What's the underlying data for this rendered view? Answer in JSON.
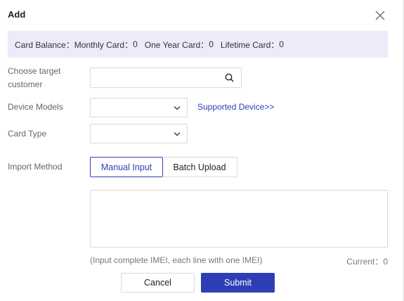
{
  "dialog": {
    "title": "Add"
  },
  "balance": {
    "card_balance_label": "Card Balance：",
    "monthly_label": "Monthly Card：",
    "monthly_value": "0",
    "one_year_label": "One Year Card：",
    "one_year_value": "0",
    "lifetime_label": "Lifetime Card：",
    "lifetime_value": "0"
  },
  "form": {
    "customer_label_line1": "Choose target",
    "customer_label_line2": "customer",
    "customer_value": "",
    "device_models_label": "Device Models",
    "device_models_value": "",
    "supported_device_link": "Supported Device>>",
    "card_type_label": "Card Type",
    "card_type_value": "",
    "import_method_label": "Import Method",
    "import_methods": [
      "Manual Input",
      "Batch Upload"
    ],
    "selected_import_method": "Manual Input",
    "imei_text": "",
    "hint": "(Input complete IMEI, each line with one IMEI)",
    "current_label": "Current：",
    "current_value": "0"
  },
  "actions": {
    "cancel_label": "Cancel",
    "submit_label": "Submit"
  },
  "colors": {
    "accent": "#2e3fb5",
    "balance_bg": "#ebebf9",
    "border": "#d9d9d9"
  },
  "icons": {
    "close": "close-icon",
    "search": "search-icon",
    "dropdown": "chevron-down-icon"
  }
}
